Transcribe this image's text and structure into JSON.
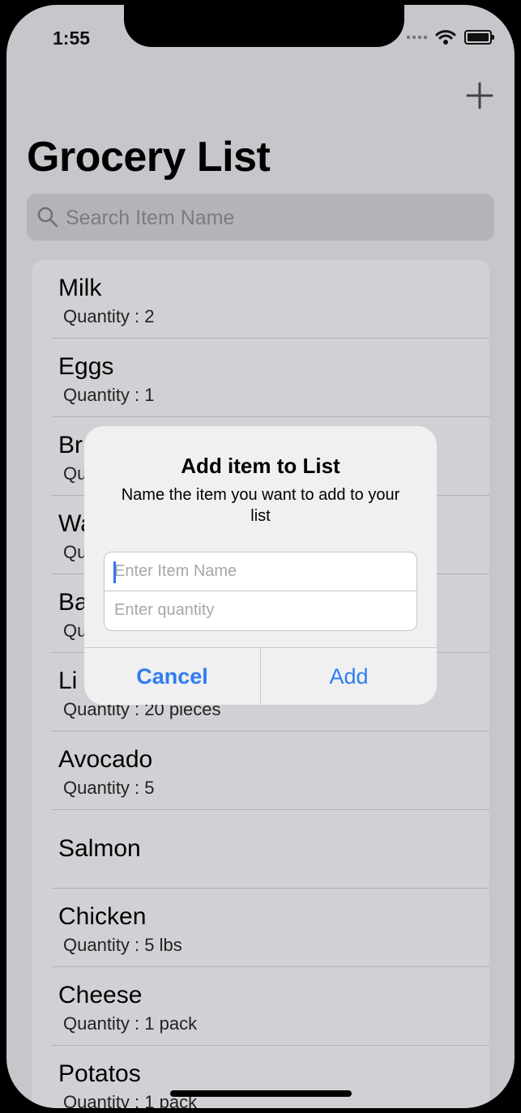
{
  "status": {
    "time": "1:55"
  },
  "nav": {
    "add_icon": "plus-icon"
  },
  "page": {
    "title": "Grocery List"
  },
  "search": {
    "placeholder": "Search Item Name",
    "icon": "search-icon"
  },
  "items": [
    {
      "name": "Milk",
      "quantity": "Quantity : 2"
    },
    {
      "name": "Eggs",
      "quantity": "Quantity : 1"
    },
    {
      "name": "Br",
      "quantity": "Qu"
    },
    {
      "name": "Wa",
      "quantity": "Qu"
    },
    {
      "name": "Ba",
      "quantity": "Qu"
    },
    {
      "name": "Li",
      "quantity": "Quantity : 20 pieces"
    },
    {
      "name": "Avocado",
      "quantity": "Quantity : 5"
    },
    {
      "name": "Salmon",
      "quantity": ""
    },
    {
      "name": "Chicken",
      "quantity": "Quantity : 5 lbs"
    },
    {
      "name": "Cheese",
      "quantity": "Quantity : 1 pack"
    },
    {
      "name": "Potatos",
      "quantity": "Quantity : 1 pack"
    }
  ],
  "alert": {
    "title": "Add item to List",
    "message": "Name the item you want to add to your list",
    "name_placeholder": "Enter Item Name",
    "quantity_placeholder": "Enter quantity",
    "cancel_label": "Cancel",
    "add_label": "Add"
  },
  "colors": {
    "accent": "#2f7cf6",
    "background": "#c6c6cb",
    "dialog": "#eff0ef"
  }
}
